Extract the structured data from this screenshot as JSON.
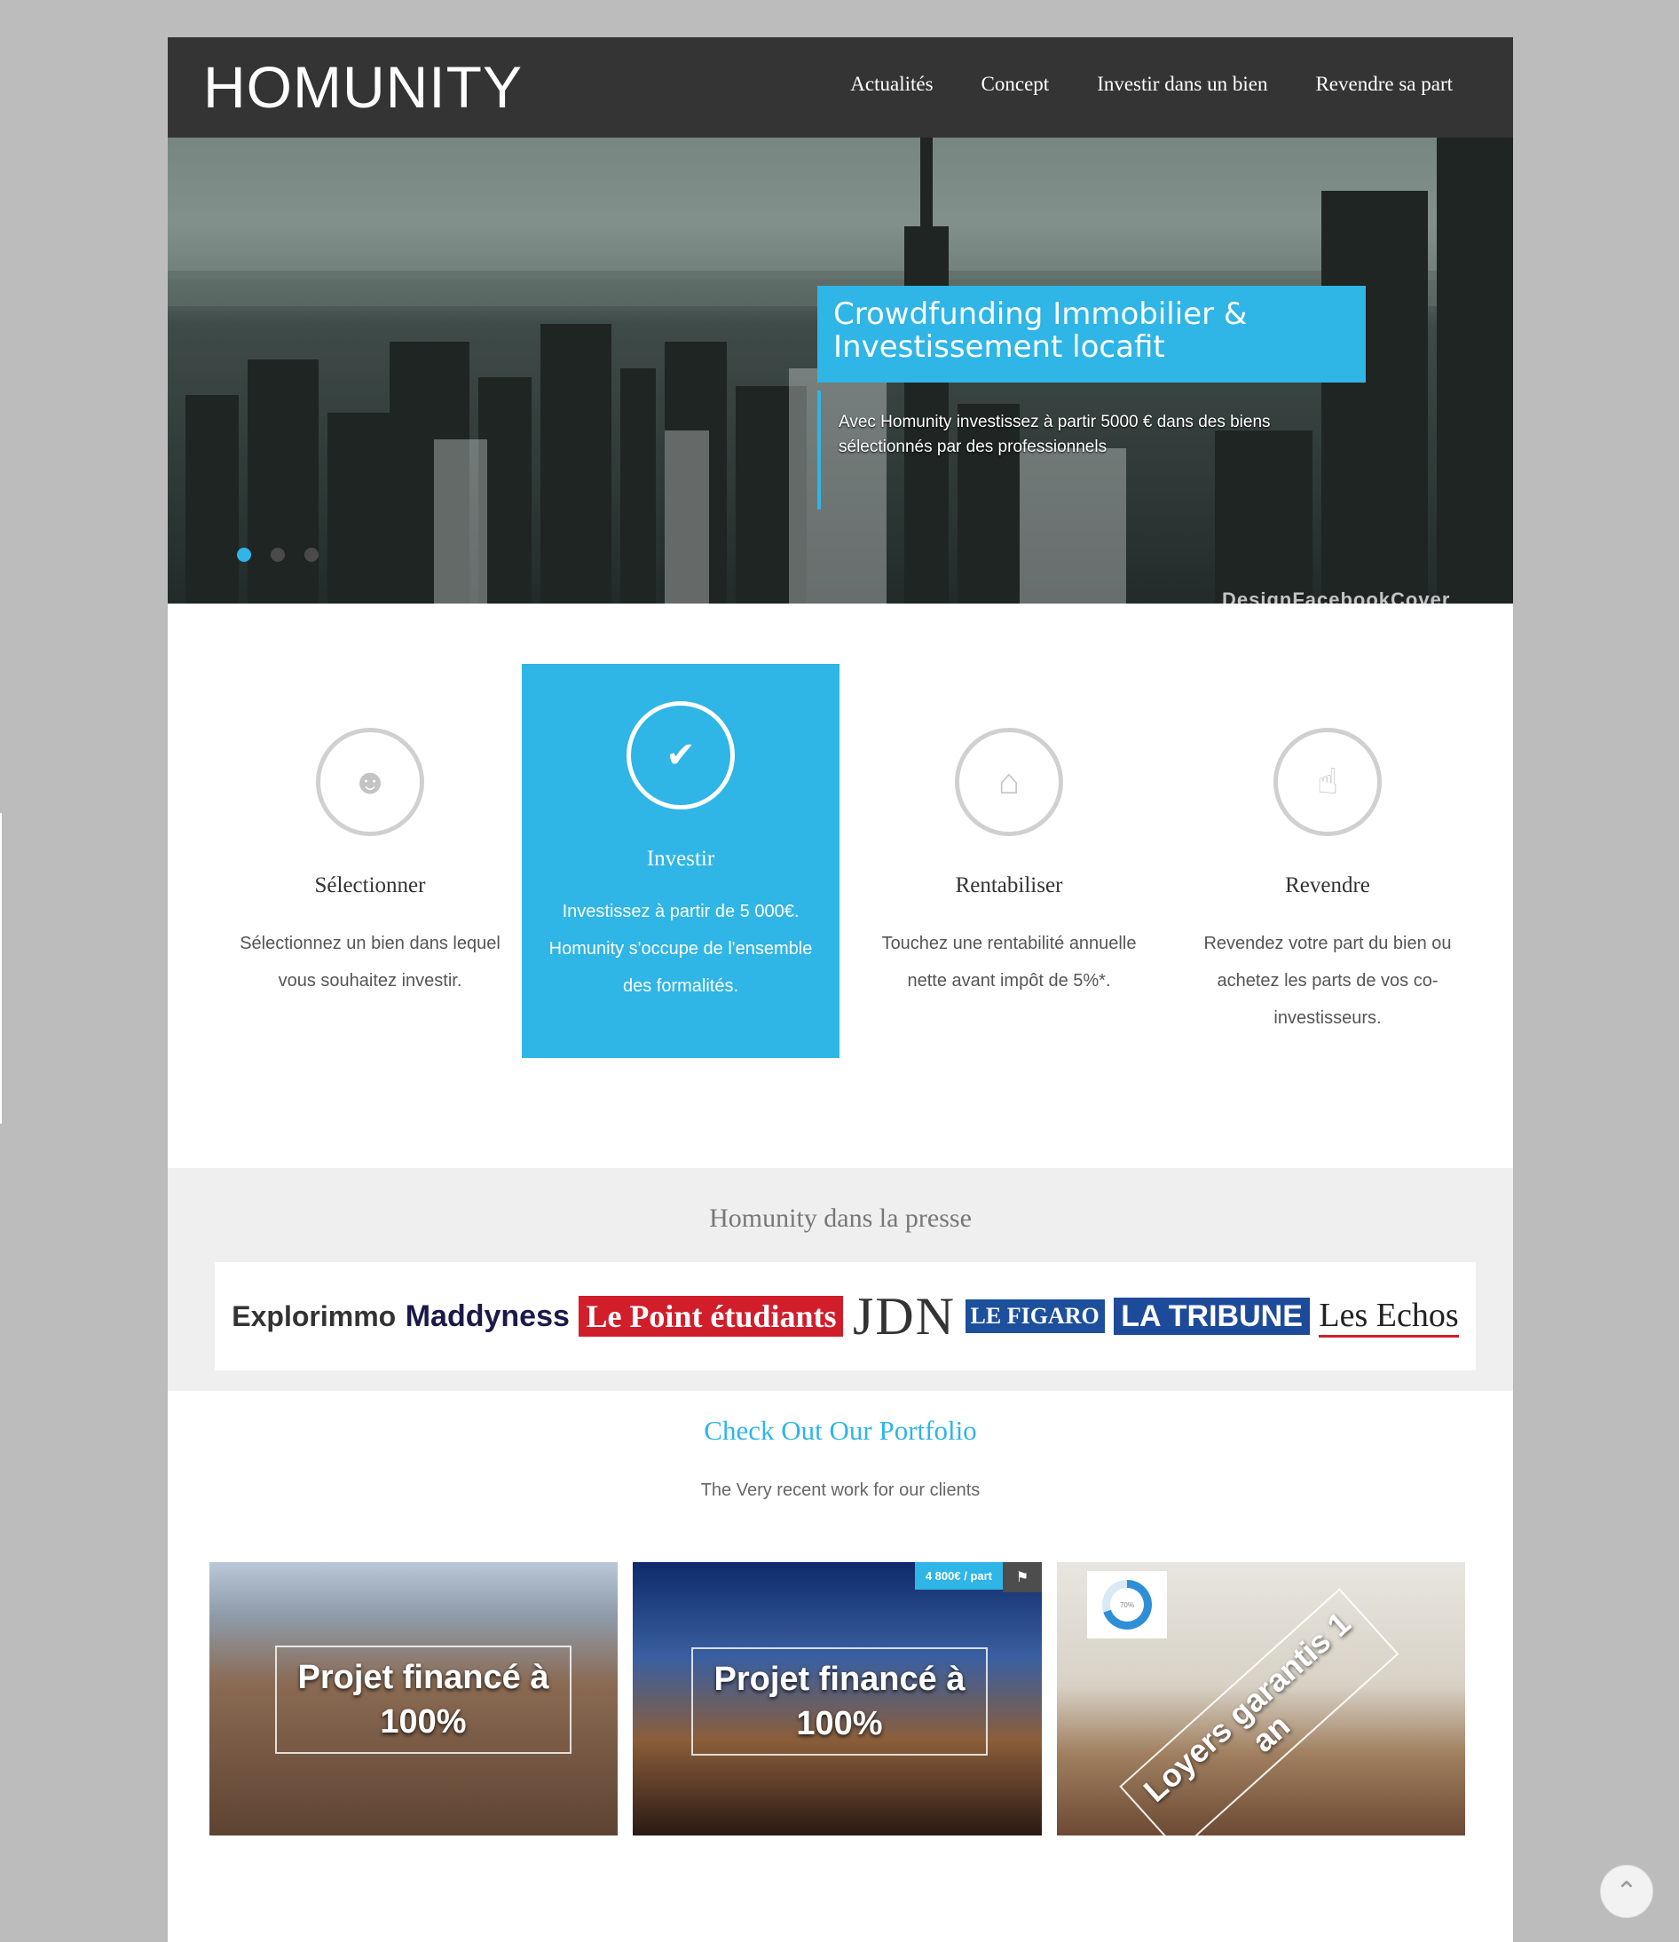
{
  "header": {
    "logo": "HOMUNITY",
    "nav": [
      "Actualités",
      "Concept",
      "Investir dans un bien",
      "Revendre sa part"
    ]
  },
  "hero": {
    "title": "Crowdfunding Immobilier & Investissement locafit",
    "subtitle": "Avec Homunity investissez à partir 5000 € dans des biens sélectionnés par des professionnels",
    "watermark": "DesignFacebookCover",
    "slides": 3,
    "active_slide": 1
  },
  "features": [
    {
      "icon": "users-icon",
      "title": "Sélectionner",
      "desc": "Sélectionnez un bien dans lequel vous souhaitez investir."
    },
    {
      "icon": "check-icon",
      "title": "Investir",
      "desc": "Investissez à partir de 5 000€. Homunity s'occupe de l'ensemble des formalités."
    },
    {
      "icon": "home-icon",
      "title": "Rentabiliser",
      "desc": "Touchez une rentabilité annuelle nette avant impôt de 5%*."
    },
    {
      "icon": "hand-pointer-icon",
      "title": "Revendre",
      "desc": "Revendez votre part du bien ou achetez les parts de vos co-investisseurs."
    }
  ],
  "press": {
    "title": "Homunity dans la presse",
    "logos": [
      "Explorimmo",
      "Maddyness",
      "Le Point étudiants",
      "JDN",
      "LE FIGARO",
      "LA TRIBUNE",
      "Les Echos"
    ]
  },
  "portfolio": {
    "title": "Check Out Our Portfolio",
    "subtitle": "The Very recent work for our clients",
    "tiles": [
      {
        "overlay": "Projet financé à 100%"
      },
      {
        "overlay": "Projet financé à 100%",
        "price": "4 800€ / part"
      },
      {
        "overlay": "Loyers garantis 1 an",
        "progress": "70%"
      }
    ]
  },
  "colors": {
    "accent": "#2fb5e6",
    "header": "#343434",
    "background": "#bcbcbc"
  }
}
